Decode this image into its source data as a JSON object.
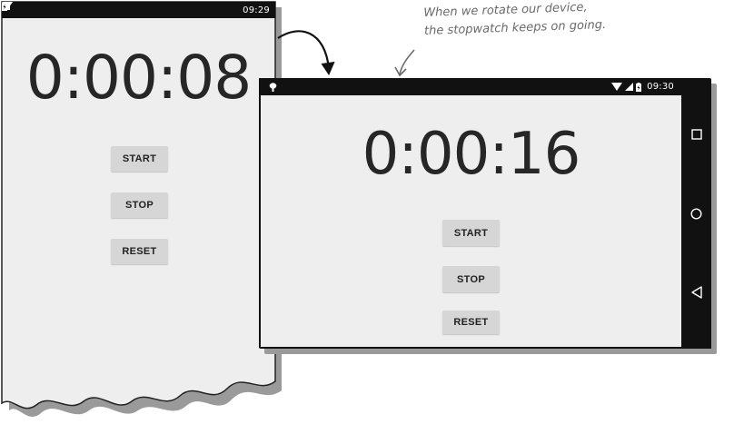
{
  "portrait": {
    "status_time": "09:29",
    "timer": "0:00:08",
    "buttons": {
      "start": "START",
      "stop": "STOP",
      "reset": "RESET"
    }
  },
  "landscape": {
    "status_time": "09:30",
    "timer": "0:00:16",
    "buttons": {
      "start": "START",
      "stop": "STOP",
      "reset": "RESET"
    },
    "nav": [
      "recents-icon",
      "home-icon",
      "back-icon"
    ]
  },
  "annotation": {
    "line1": "When we rotate our device,",
    "line2": "the stopwatch keeps on going."
  },
  "colors": {
    "screen": "#eeeeee",
    "status_bar": "#111111",
    "button": "#d6d6d6",
    "timer_text": "#262626",
    "annotation": "#6a6a6a"
  }
}
